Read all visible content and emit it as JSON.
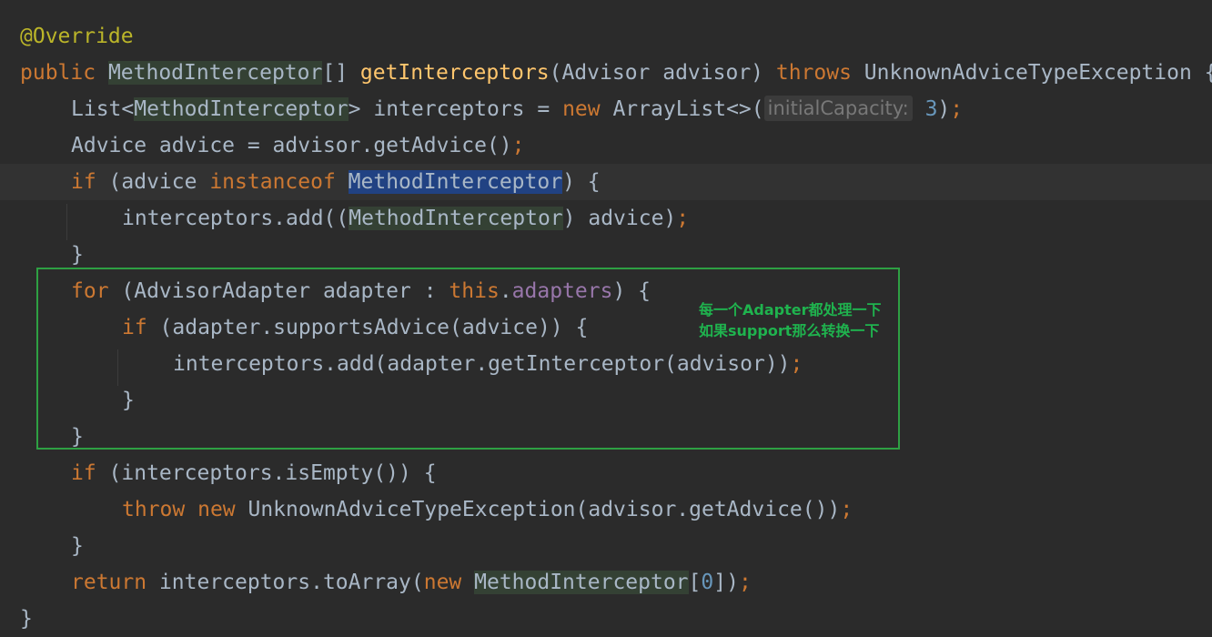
{
  "editor": {
    "lines": [
      {
        "indent": 0,
        "tokens": [
          {
            "t": "@Override",
            "c": "a"
          }
        ]
      },
      {
        "indent": 0,
        "tokens": [
          {
            "t": "public ",
            "c": "k"
          },
          {
            "t": "MethodInterceptor",
            "c": "hl"
          },
          {
            "t": "[] "
          },
          {
            "t": "getInterceptors",
            "c": "f"
          },
          {
            "t": "(Advisor advisor) "
          },
          {
            "t": "throws ",
            "c": "k"
          },
          {
            "t": "UnknownAdviceTypeException {"
          }
        ]
      },
      {
        "indent": 1,
        "tokens": [
          {
            "t": "List<"
          },
          {
            "t": "MethodInterceptor",
            "c": "hl"
          },
          {
            "t": "> interceptors = "
          },
          {
            "t": "new ",
            "c": "k"
          },
          {
            "t": "ArrayList<>("
          },
          {
            "t": "initialCapacity:",
            "c": "hint"
          },
          {
            "t": " "
          },
          {
            "t": "3",
            "c": "n"
          },
          {
            "t": ")"
          },
          {
            "t": ";",
            "c": "k"
          }
        ]
      },
      {
        "indent": 1,
        "tokens": [
          {
            "t": "Advice advice = advisor.getAdvice()"
          },
          {
            "t": ";",
            "c": "k"
          }
        ]
      },
      {
        "indent": 1,
        "caret": true,
        "tokens": [
          {
            "t": "if ",
            "c": "k"
          },
          {
            "t": "(advice "
          },
          {
            "t": "instanceof ",
            "c": "k"
          },
          {
            "t": "MethodInterceptor",
            "c": "sel"
          },
          {
            "t": ") {"
          }
        ]
      },
      {
        "indent": 2,
        "tokens": [
          {
            "t": "interceptors.add(("
          },
          {
            "t": "MethodInterceptor",
            "c": "hl"
          },
          {
            "t": ") advice)"
          },
          {
            "t": ";",
            "c": "k"
          }
        ]
      },
      {
        "indent": 1,
        "tokens": [
          {
            "t": "}"
          }
        ]
      },
      {
        "indent": 1,
        "tokens": [
          {
            "t": "for ",
            "c": "k"
          },
          {
            "t": "(AdvisorAdapter adapter : "
          },
          {
            "t": "this",
            "c": "k"
          },
          {
            "t": "."
          },
          {
            "t": "adapters",
            "c": "fld"
          },
          {
            "t": ") {"
          }
        ]
      },
      {
        "indent": 2,
        "tokens": [
          {
            "t": "if ",
            "c": "k"
          },
          {
            "t": "(adapter.supportsAdvice(advice)) {"
          }
        ]
      },
      {
        "indent": 3,
        "tokens": [
          {
            "t": "interceptors.add(adapter.getInterceptor(advisor))"
          },
          {
            "t": ";",
            "c": "k"
          }
        ]
      },
      {
        "indent": 2,
        "tokens": [
          {
            "t": "}"
          }
        ]
      },
      {
        "indent": 1,
        "tokens": [
          {
            "t": "}"
          }
        ]
      },
      {
        "indent": 1,
        "tokens": [
          {
            "t": "if ",
            "c": "k"
          },
          {
            "t": "(interceptors.isEmpty()) {"
          }
        ]
      },
      {
        "indent": 2,
        "tokens": [
          {
            "t": "throw ",
            "c": "k"
          },
          {
            "t": "new ",
            "c": "k"
          },
          {
            "t": "UnknownAdviceTypeException(advisor.getAdvice())"
          },
          {
            "t": ";",
            "c": "k"
          }
        ]
      },
      {
        "indent": 1,
        "tokens": [
          {
            "t": "}"
          }
        ]
      },
      {
        "indent": 1,
        "tokens": [
          {
            "t": "return ",
            "c": "k"
          },
          {
            "t": "interceptors.toArray("
          },
          {
            "t": "new ",
            "c": "k"
          },
          {
            "t": "MethodInterceptor",
            "c": "hl"
          },
          {
            "t": "["
          },
          {
            "t": "0",
            "c": "n"
          },
          {
            "t": "])"
          },
          {
            "t": ";",
            "c": "k"
          }
        ]
      },
      {
        "indent": 0,
        "tokens": [
          {
            "t": "}"
          }
        ]
      }
    ]
  },
  "annotation": {
    "line1": "每一个Adapter都处理一下",
    "line2": "如果support那么转换一下",
    "color": "#1fb34e"
  }
}
